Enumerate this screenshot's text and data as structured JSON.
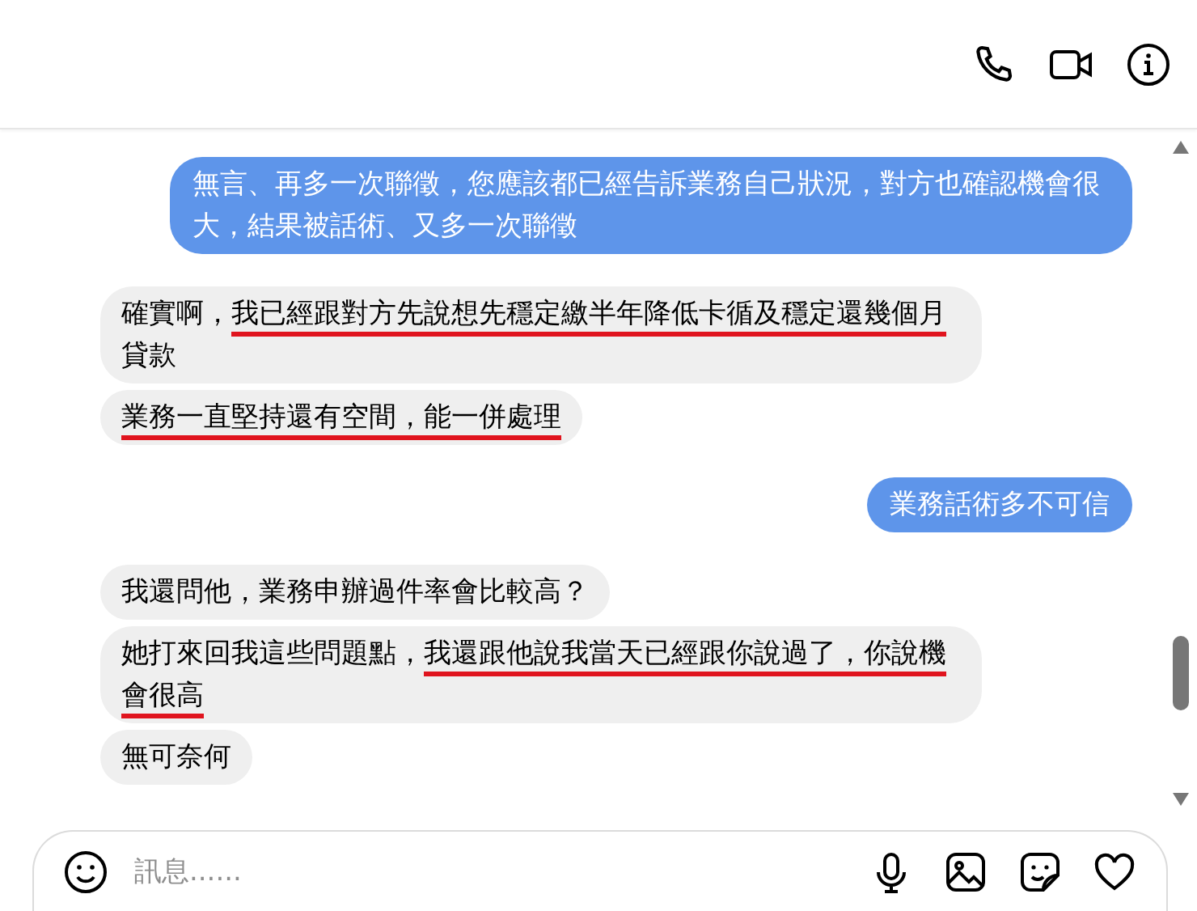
{
  "messages": [
    {
      "kind": "sent",
      "parts": [
        {
          "text": "無言、再多一次聯徵，您應該都已經告訴業務自己狀況，對方也確認機會很大，結果被話術、又多一次聯徵",
          "underlined": false
        }
      ]
    },
    {
      "kind": "received",
      "parts": [
        {
          "text": "確實啊，",
          "underlined": false
        },
        {
          "text": "我已經跟對方先說想先穩定繳半年降低卡循及穩定還幾個月",
          "underlined": true
        },
        {
          "text": "貸款",
          "underlined": false
        }
      ]
    },
    {
      "kind": "received",
      "parts": [
        {
          "text": "業務一直堅持還有空間，能一併處理",
          "underlined": true
        }
      ]
    },
    {
      "kind": "sent",
      "parts": [
        {
          "text": "業務話術多不可信",
          "underlined": false
        }
      ]
    },
    {
      "kind": "received",
      "parts": [
        {
          "text": "我還問他，業務申辦過件率會比較高？",
          "underlined": false
        }
      ]
    },
    {
      "kind": "received",
      "parts": [
        {
          "text": "她打來回我這些問題點，",
          "underlined": false
        },
        {
          "text": "我還跟他說我當天已經跟你說過了，你說機會很高",
          "underlined": true
        }
      ]
    },
    {
      "kind": "received",
      "parts": [
        {
          "text": "無可奈何",
          "underlined": false
        }
      ]
    }
  ],
  "composer": {
    "placeholder": "訊息......"
  }
}
